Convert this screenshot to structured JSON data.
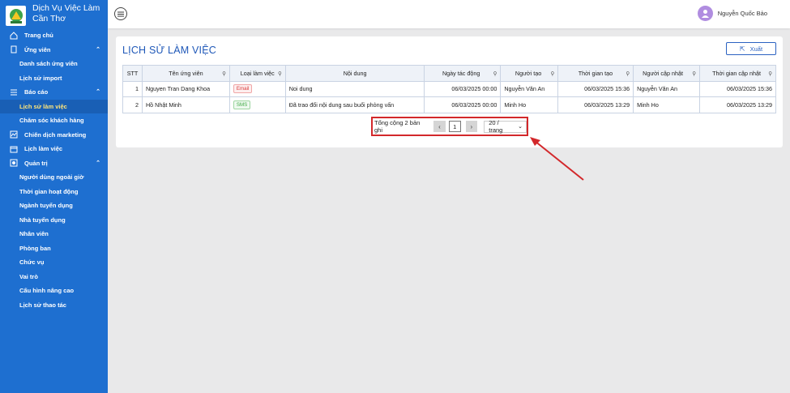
{
  "brand": {
    "line1": "Dịch Vụ Việc Làm",
    "line2": "Cần Thơ"
  },
  "sidebar": {
    "items": [
      {
        "label": "Trang chủ"
      },
      {
        "label": "Ứng viên"
      },
      {
        "label": "Danh sách ứng viên"
      },
      {
        "label": "Lịch sử import"
      },
      {
        "label": "Báo cáo"
      },
      {
        "label": "Lịch sử làm việc"
      },
      {
        "label": "Chăm sóc khách hàng"
      },
      {
        "label": "Chiến dịch marketing"
      },
      {
        "label": "Lịch làm việc"
      },
      {
        "label": "Quản trị"
      },
      {
        "label": "Người dùng ngoài giờ"
      },
      {
        "label": "Thời gian hoạt động"
      },
      {
        "label": "Ngành tuyển dụng"
      },
      {
        "label": "Nhà tuyển dụng"
      },
      {
        "label": "Nhân viên"
      },
      {
        "label": "Phòng ban"
      },
      {
        "label": "Chức vụ"
      },
      {
        "label": "Vai trò"
      },
      {
        "label": "Cấu hình nâng cao"
      },
      {
        "label": "Lịch sử thao tác"
      }
    ]
  },
  "header": {
    "user_name": "Nguyễn Quốc Bảo"
  },
  "page": {
    "title": "LỊCH SỬ LÀM VIỆC",
    "export_label": "Xuất"
  },
  "table": {
    "columns": [
      "STT",
      "Tên ứng viên",
      "Loại làm việc",
      "Nội dung",
      "Ngày tác động",
      "Người tạo",
      "Thời gian tạo",
      "Người cập nhật",
      "Thời gian cập nhật"
    ],
    "rows": [
      {
        "stt": "1",
        "name": "Nguyen Tran Dang Khoa",
        "type": "Email",
        "content": "Noi dung",
        "date": "06/03/2025 00:00",
        "creator": "Nguyễn Văn An",
        "created": "06/03/2025 15:36",
        "updater": "Nguyễn Văn An",
        "updated": "06/03/2025 15:36"
      },
      {
        "stt": "2",
        "name": "Hồ Nhật Minh",
        "type": "SMS",
        "content": "Đã trao đổi nội dung sau buổi phỏng vấn",
        "date": "06/03/2025 00:00",
        "creator": "Minh Ho",
        "created": "06/03/2025 13:29",
        "updater": "Minh Ho",
        "updated": "06/03/2025 13:29"
      }
    ]
  },
  "pagination": {
    "total_text": "Tổng cộng 2 bản ghi",
    "current_page": "1",
    "page_size": "20 / trang"
  },
  "colors": {
    "sidebar": "#1e6fd0",
    "accent": "#1f58b8",
    "highlight": "#d3282b"
  }
}
